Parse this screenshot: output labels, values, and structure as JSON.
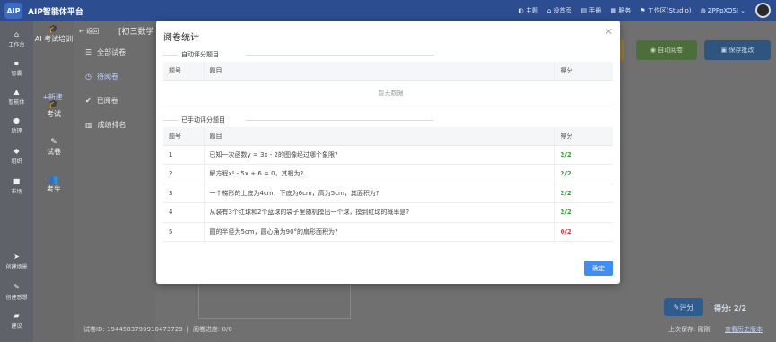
{
  "app": {
    "logo": "AIP",
    "title": "AIP智能体平台"
  },
  "topbar": {
    "items": [
      "主题",
      "设首页",
      "手册",
      "服务",
      "工作区(Studio)"
    ],
    "user": "ZPPpXOSI"
  },
  "sidebar": {
    "items": [
      {
        "label": "工作台",
        "icon": "home-icon"
      },
      {
        "label": "智囊",
        "icon": "box-icon"
      },
      {
        "label": "智能体",
        "icon": "warning-icon"
      },
      {
        "label": "助理",
        "icon": "user-icon"
      },
      {
        "label": "组织",
        "icon": "org-icon"
      },
      {
        "label": "市场",
        "icon": "market-icon"
      },
      {
        "label": "创建场景",
        "icon": "send-icon"
      },
      {
        "label": "创建感想",
        "icon": "pen-icon"
      },
      {
        "label": "建议",
        "icon": "chat-icon"
      }
    ]
  },
  "second_nav": {
    "ai_training": "AI 考试培训",
    "new": "+新建",
    "exam": "考试",
    "paper": "试卷",
    "student": "考生"
  },
  "third_nav": {
    "back": "返回",
    "all_papers": "全部试卷",
    "pending": "待阅卷",
    "done": "已阅卷",
    "ranking": "成绩排名"
  },
  "main": {
    "class_title": "[初三数学",
    "auto_grade": "自动阅卷",
    "save_grade": "保存批改",
    "paper_id_label": "试卷ID: 1944583799910473729",
    "progress_label": "阅卷进度: 0/0",
    "score_button": "评分",
    "score": "得分: 2/2",
    "last_save": "上次保存: 刚刚",
    "history": "查看历史版本"
  },
  "modal": {
    "title": "阅卷统计",
    "auto_section": "自动评分题目",
    "manual_section": "已手动评分题目",
    "headers": {
      "no": "题号",
      "question": "题目",
      "score": "得分"
    },
    "empty_text": "暂无数据",
    "rows": [
      {
        "no": "1",
        "question": "已知一次函数y = 3x - 2的图像经过哪个象限?",
        "score": "2/2",
        "status": "ok"
      },
      {
        "no": "2",
        "question": "解方程x² - 5x + 6 = 0，其根为?",
        "score": "2/2",
        "status": "ok"
      },
      {
        "no": "3",
        "question": "一个梯形的上底为4cm，下底为6cm，高为5cm，其面积为?",
        "score": "2/2",
        "status": "ok"
      },
      {
        "no": "4",
        "question": "从装有3个红球和2个蓝球的袋子里随机摸出一个球，摸到红球的概率是?",
        "score": "2/2",
        "status": "ok"
      },
      {
        "no": "5",
        "question": "圆的半径为5cm，圆心角为90°的扇形面积为?",
        "score": "0/2",
        "status": "bad"
      }
    ],
    "confirm": "确定"
  }
}
